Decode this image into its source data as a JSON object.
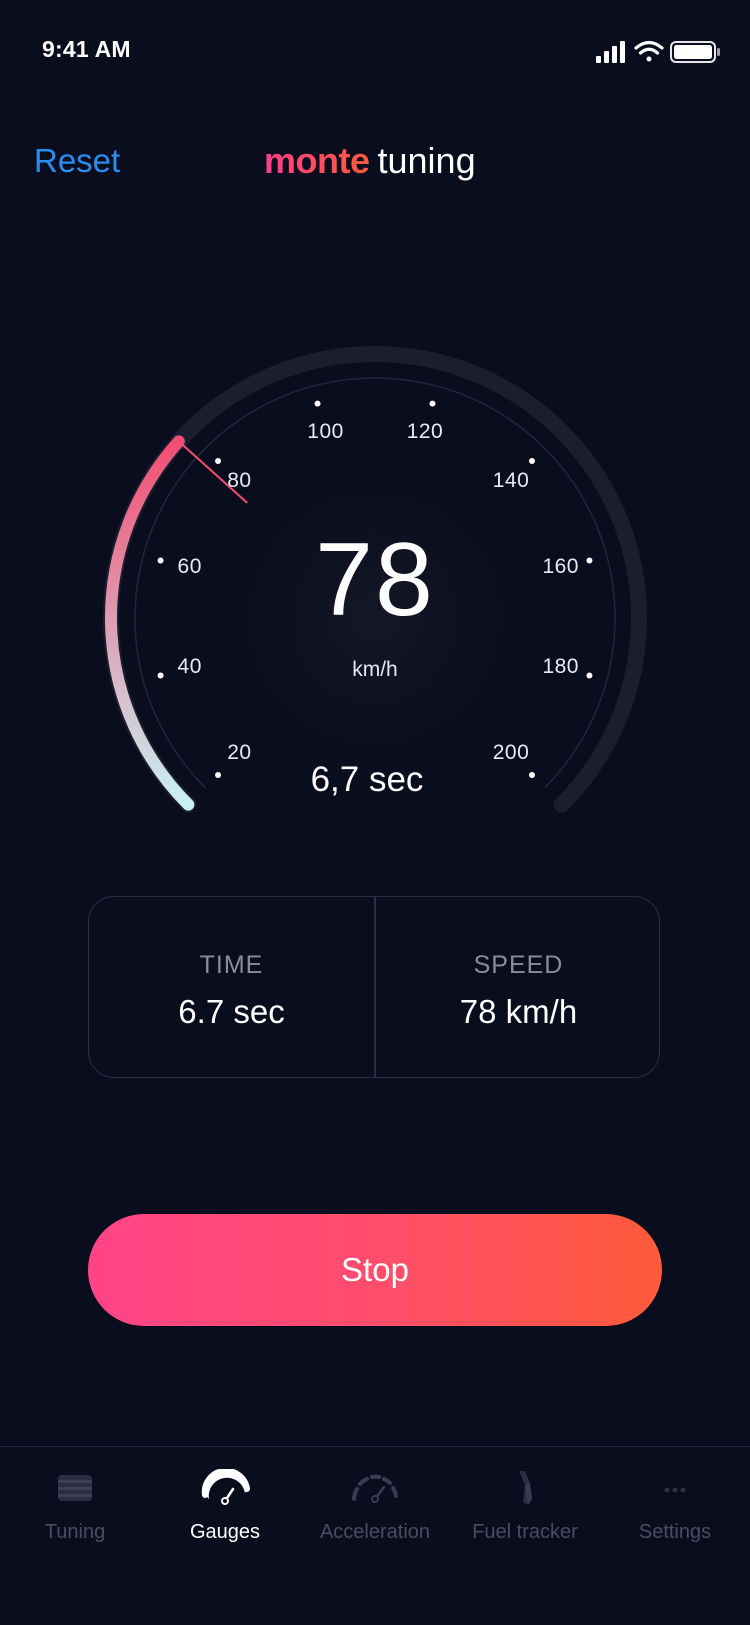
{
  "status_bar": {
    "time": "9:41 AM"
  },
  "header": {
    "reset_label": "Reset",
    "logo_brand": "monte",
    "logo_rest": "tuning"
  },
  "gauge": {
    "speed": 78,
    "speed_display": "78",
    "unit": "km/h",
    "elapsed": "6,7 sec",
    "min": 20,
    "max": 200,
    "ticks": [
      {
        "label": "20",
        "value": 20
      },
      {
        "label": "40",
        "value": 40
      },
      {
        "label": "60",
        "value": 60
      },
      {
        "label": "80",
        "value": 80
      },
      {
        "label": "100",
        "value": 100
      },
      {
        "label": "120",
        "value": 120
      },
      {
        "label": "140",
        "value": 140
      },
      {
        "label": "160",
        "value": 160
      },
      {
        "label": "180",
        "value": 180
      },
      {
        "label": "200",
        "value": 200
      }
    ],
    "colors": {
      "arc_start": "#c9f1f3",
      "arc_end": "#f34d72",
      "track": "#1b1e2e"
    }
  },
  "stats": {
    "time_label": "TIME",
    "time_value": "6.7 sec",
    "speed_label": "SPEED",
    "speed_value": "78 km/h"
  },
  "action": {
    "stop_label": "Stop",
    "colors": {
      "start": "#ff4487",
      "end": "#ff5a3a"
    }
  },
  "tabbar": {
    "items": [
      {
        "label": "Tuning",
        "icon": "tuning-icon",
        "active": false
      },
      {
        "label": "Gauges",
        "icon": "gauge-icon",
        "active": true
      },
      {
        "label": "Acceleration",
        "icon": "acceleration-icon",
        "active": false
      },
      {
        "label": "Fuel tracker",
        "icon": "fuel-nozzle-icon",
        "active": false
      },
      {
        "label": "Settings",
        "icon": "more-dots-icon",
        "active": false
      }
    ]
  }
}
